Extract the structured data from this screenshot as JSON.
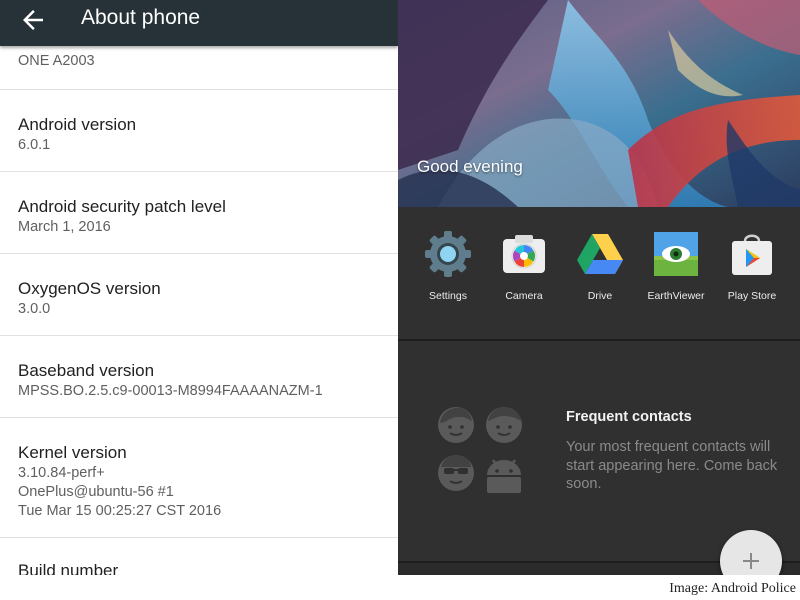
{
  "appbar": {
    "title": "About phone",
    "back_icon": "arrow-back-icon"
  },
  "settings": {
    "model": "ONE A2003",
    "android": {
      "title": "Android version",
      "value": "6.0.1"
    },
    "patch": {
      "title": "Android security patch level",
      "value": "March 1, 2016"
    },
    "oxygen": {
      "title": "OxygenOS version",
      "value": "3.0.0"
    },
    "baseband": {
      "title": "Baseband version",
      "value": "MPSS.BO.2.5.c9-00013-M8994FAAAANAZM-1"
    },
    "kernel": {
      "title": "Kernel version",
      "lines": [
        "3.10.84-perf+",
        "OnePlus@ubuntu-56 #1",
        "Tue Mar 15 00:25:27 CST 2016"
      ]
    },
    "build": {
      "title": "Build number"
    }
  },
  "launcher": {
    "greeting": "Good evening",
    "apps": [
      {
        "label": "Settings",
        "icon": "settings-gear-icon"
      },
      {
        "label": "Camera",
        "icon": "camera-icon"
      },
      {
        "label": "Drive",
        "icon": "google-drive-icon"
      },
      {
        "label": "EarthViewer",
        "icon": "earthviewer-eye-icon"
      },
      {
        "label": "Play Store",
        "icon": "play-store-icon"
      }
    ],
    "contacts": {
      "title": "Frequent contacts",
      "description": "Your most frequent contacts will start appearing here. Come back soon."
    },
    "fab_icon": "plus-icon"
  },
  "credit": "Image: Android Police",
  "colors": {
    "appbar": "#263238",
    "launcher_bg": "#303030",
    "drive_green": "#1fa463",
    "drive_yellow": "#ffd04b",
    "drive_blue": "#4688f4"
  }
}
